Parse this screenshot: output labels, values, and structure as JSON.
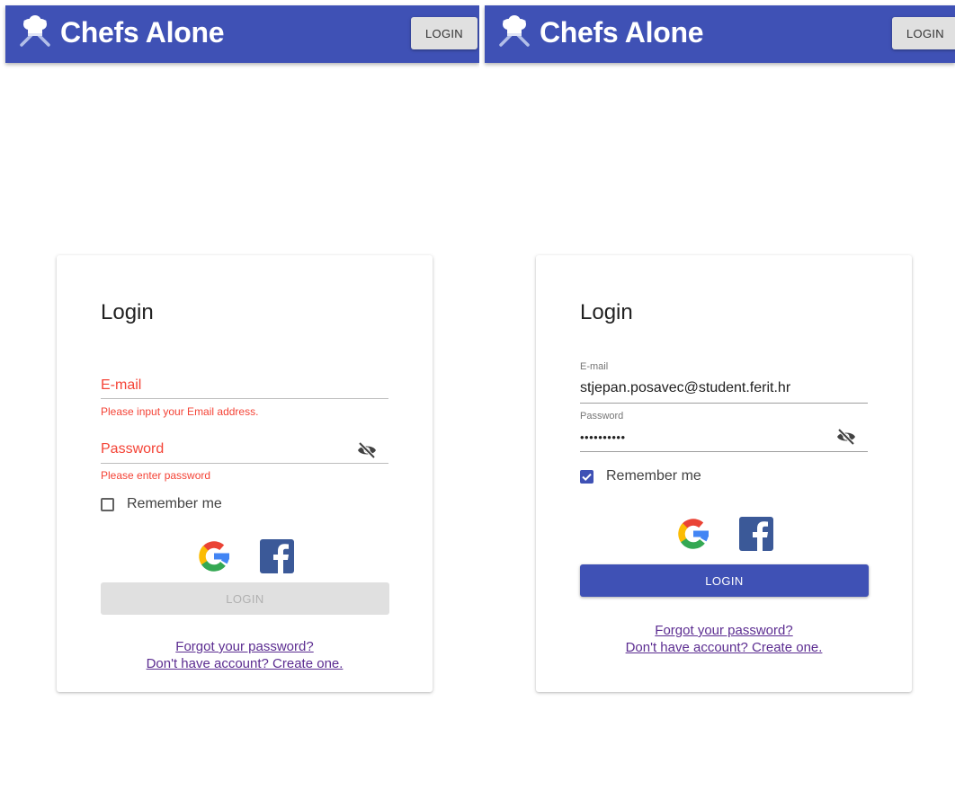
{
  "app": {
    "title": "Chefs Alone",
    "login_label": "LOGIN"
  },
  "colors": {
    "primary": "#3f51b5",
    "error": "#f44336",
    "link": "#5c2d91"
  },
  "icons": {
    "logo": "chef-hat-utensils-icon",
    "visibility": "eye-off-icon",
    "google": "google-icon",
    "facebook": "facebook-icon"
  },
  "left": {
    "title": "Login",
    "email_label": "E-mail",
    "email_error": "Please input your Email address.",
    "password_label": "Password",
    "password_error": "Please enter password",
    "remember_label": "Remember me",
    "remember_checked": false,
    "login_label": "LOGIN",
    "forgot_label": "Forgot your password?",
    "create_label": "Don't have account? Create one."
  },
  "right": {
    "title": "Login",
    "email_label": "E-mail",
    "email_value": "stjepan.posavec@student.ferit.hr",
    "password_label": "Password",
    "password_value": "••••••••••",
    "remember_label": "Remember me",
    "remember_checked": true,
    "login_label": "LOGIN",
    "forgot_label": "Forgot your password?",
    "create_label": "Don't have account? Create one."
  }
}
